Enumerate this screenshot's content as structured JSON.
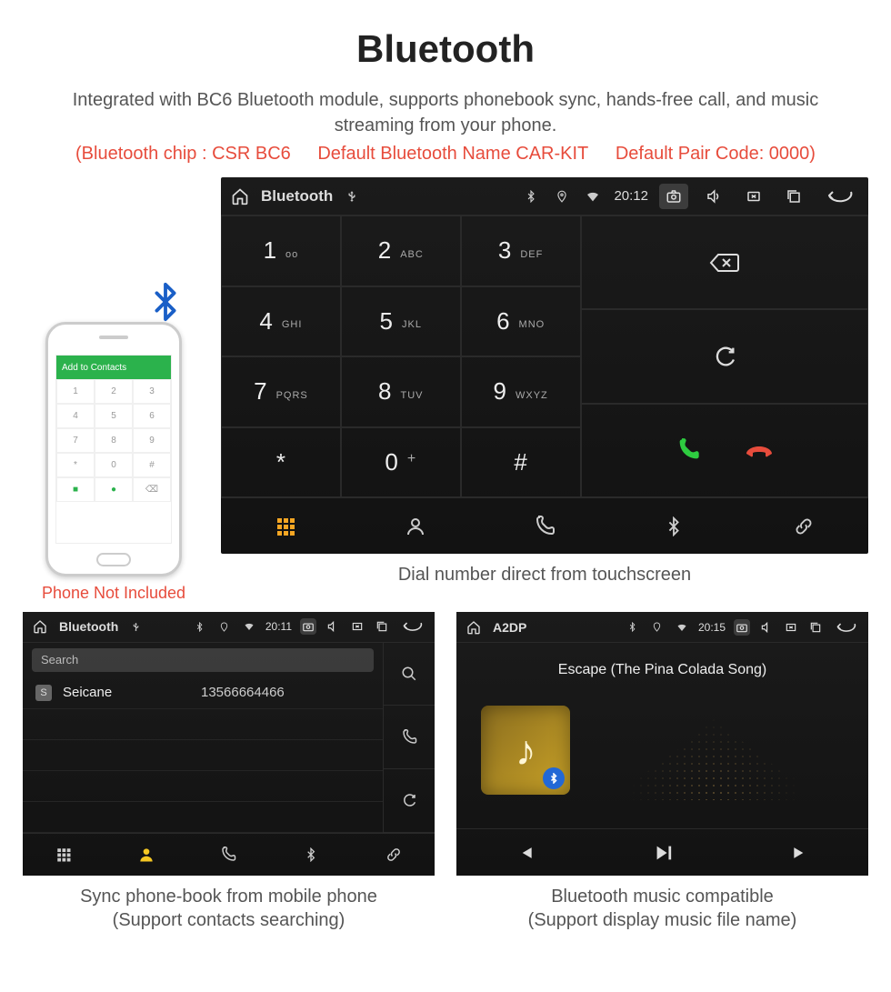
{
  "header": {
    "title": "Bluetooth",
    "description": "Integrated with BC6 Bluetooth module, supports phonebook sync, hands-free call, and music streaming from your phone.",
    "spec_chip": "(Bluetooth chip : CSR BC6",
    "spec_name": "Default Bluetooth Name CAR-KIT",
    "spec_code": "Default Pair Code: 0000)"
  },
  "phone": {
    "not_included": "Phone Not Included",
    "add_to_contacts": "Add to Contacts",
    "keys": [
      "1",
      "2",
      "3",
      "4",
      "5",
      "6",
      "7",
      "8",
      "9",
      "*",
      "0",
      "#"
    ]
  },
  "dialer": {
    "app_title": "Bluetooth",
    "time": "20:12",
    "keys": [
      {
        "digit": "1",
        "sub": "oo"
      },
      {
        "digit": "2",
        "sub": "ABC"
      },
      {
        "digit": "3",
        "sub": "DEF"
      },
      {
        "digit": "4",
        "sub": "GHI"
      },
      {
        "digit": "5",
        "sub": "JKL"
      },
      {
        "digit": "6",
        "sub": "MNO"
      },
      {
        "digit": "7",
        "sub": "PQRS"
      },
      {
        "digit": "8",
        "sub": "TUV"
      },
      {
        "digit": "9",
        "sub": "WXYZ"
      },
      {
        "digit": "*",
        "sub": ""
      },
      {
        "digit": "0",
        "sub": "+"
      },
      {
        "digit": "#",
        "sub": ""
      }
    ],
    "caption": "Dial number direct from touchscreen"
  },
  "contacts": {
    "app_title": "Bluetooth",
    "time": "20:11",
    "search_placeholder": "Search",
    "contact_letter": "S",
    "contact_name": "Seicane",
    "contact_number": "13566664466",
    "caption_line1": "Sync phone-book from mobile phone",
    "caption_line2": "(Support contacts searching)"
  },
  "music": {
    "app_title": "A2DP",
    "time": "20:15",
    "track": "Escape (The Pina Colada Song)",
    "caption_line1": "Bluetooth music compatible",
    "caption_line2": "(Support display music file name)"
  }
}
